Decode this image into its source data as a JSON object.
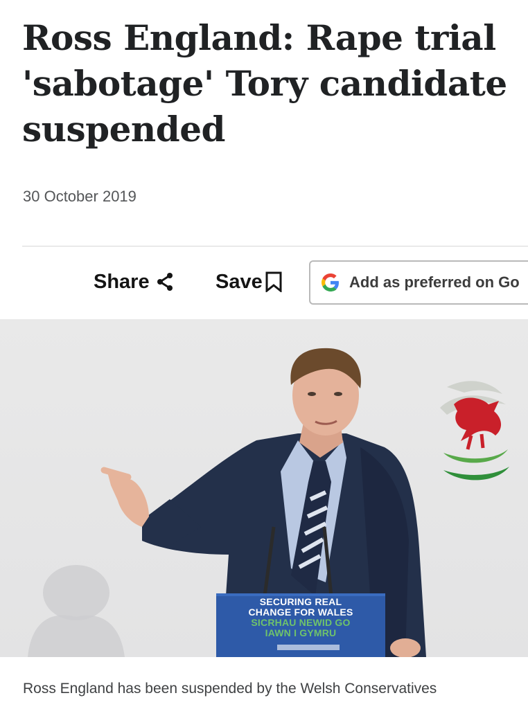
{
  "article": {
    "headline": "Ross England: Rape trial 'sabotage' Tory candidate suspended",
    "date": "30 October 2019",
    "caption": "Ross England has been suspended by the Welsh Conservatives"
  },
  "toolbar": {
    "share_label": "Share",
    "save_label": "Save",
    "preferred_label": "Add as preferred on Go"
  },
  "photo": {
    "lectern_lines_en": [
      "SECURING REAL",
      "CHANGE FOR WALES"
    ],
    "lectern_lines_cy": [
      "SICRHAU NEWID GO",
      "IAWN I GYMRU"
    ]
  },
  "colors": {
    "google_blue": "#4285F4",
    "google_red": "#EA4335",
    "google_yellow": "#FBBC05",
    "google_green": "#34A853",
    "lectern_blue": "#2e5aa8",
    "welsh_green": "#6fc36b"
  }
}
